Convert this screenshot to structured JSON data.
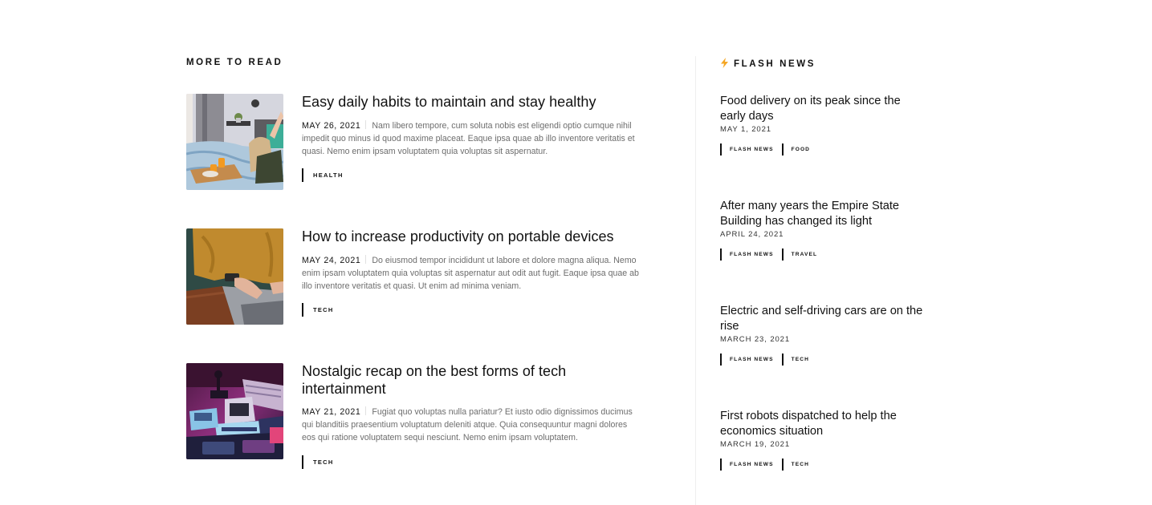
{
  "more_to_read": {
    "title": "MORE TO READ",
    "posts": [
      {
        "title": "Easy daily habits to maintain and stay healthy",
        "date": "MAY 26, 2021",
        "excerpt": "Nam libero tempore, cum soluta nobis est eligendi optio cumque nihil impedit quo minus id quod maxime placeat. Eaque ipsa quae ab illo inventore veritatis et quasi. Nemo enim ipsam voluptatem quia voluptas sit aspernatur.",
        "tags": [
          "HEALTH"
        ],
        "image": "woman-breakfast-in-bed-photo"
      },
      {
        "title": "How to increase productivity on portable devices",
        "date": "MAY 24, 2021",
        "excerpt": "Do eiusmod tempor incididunt ut labore et dolore magna aliqua. Nemo enim ipsam voluptatem quia voluptas sit aspernatur aut odit aut fugit. Eaque ipsa quae ab illo inventore veritatis et quasi. Ut enim ad minima veniam.",
        "tags": [
          "TECH"
        ],
        "image": "hands-typing-laptop-photo"
      },
      {
        "title": "Nostalgic recap on the best forms of tech intertainment",
        "date": "MAY 21, 2021",
        "excerpt": "Fugiat quo voluptas nulla pariatur? Et iusto odio dignissimos ducimus qui blanditiis praesentium voluptatum deleniti atque. Quia consequuntur magni dolores eos qui ratione voluptatem sequi nesciunt. Nemo enim ipsam voluptatem.",
        "tags": [
          "TECH"
        ],
        "image": "retro-computers-neon-photo"
      }
    ]
  },
  "flash_news": {
    "title": "FLASH NEWS",
    "icon": "lightning-bolt-icon",
    "accent_color": "#f5a623",
    "items": [
      {
        "title": "Food delivery on its peak since the early days",
        "date": "MAY 1, 2021",
        "tags": [
          "FLASH NEWS",
          "FOOD"
        ]
      },
      {
        "title": "After many years the Empire State Building has changed its light",
        "date": "APRIL 24, 2021",
        "tags": [
          "FLASH NEWS",
          "TRAVEL"
        ]
      },
      {
        "title": "Electric and self-driving cars are on the rise",
        "date": "MARCH 23, 2021",
        "tags": [
          "FLASH NEWS",
          "TECH"
        ]
      },
      {
        "title": "First robots dispatched to help the economics situation",
        "date": "MARCH 19, 2021",
        "tags": [
          "FLASH NEWS",
          "TECH"
        ]
      }
    ]
  }
}
